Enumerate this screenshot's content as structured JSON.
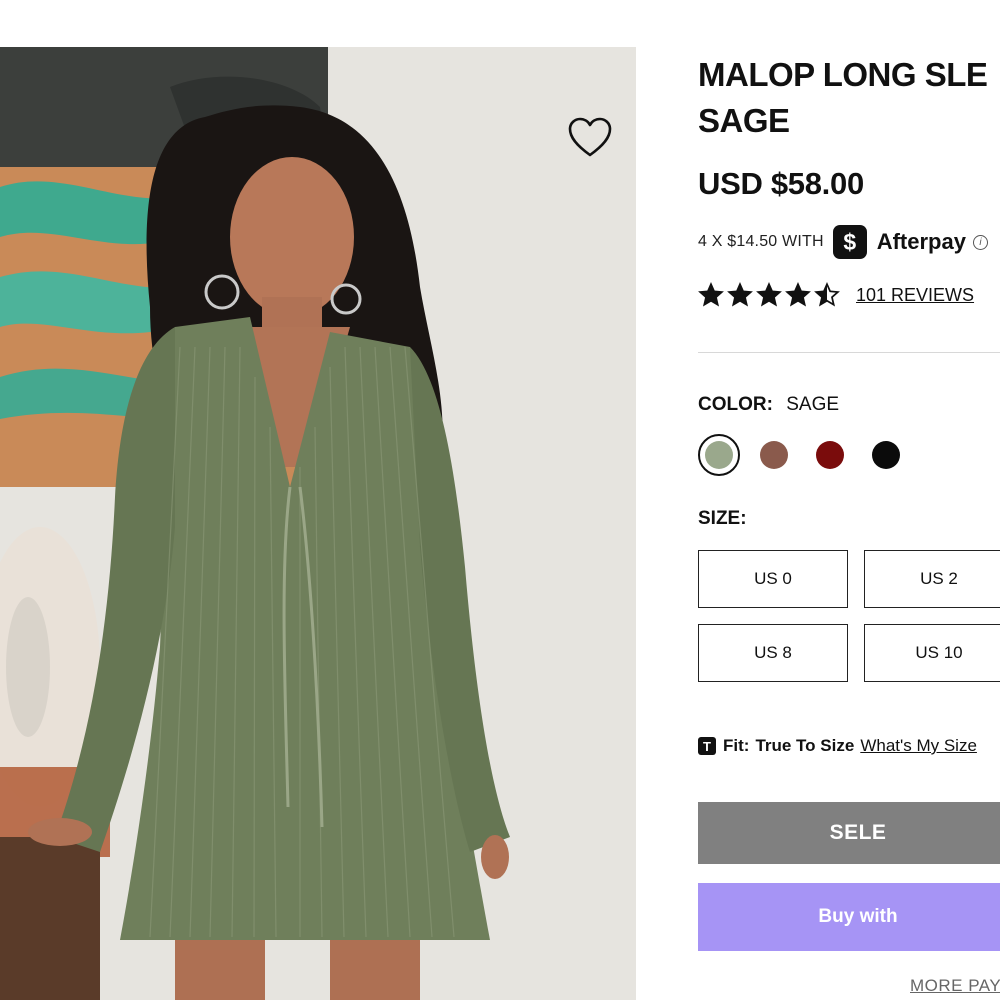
{
  "product": {
    "title_line1": "MALOP LONG SLE",
    "title_line2": "SAGE",
    "price": "USD $58.00",
    "image_alt_icon": "product-photo"
  },
  "afterpay": {
    "installments_text": "4 X $14.50 WITH",
    "badge_glyph": "$",
    "brand": "Afterpay",
    "info_glyph": "i"
  },
  "rating": {
    "stars": 4.5,
    "reviews_label": "101 REVIEWS"
  },
  "color": {
    "label": "COLOR:",
    "selected": "SAGE",
    "swatches": [
      {
        "name": "sage",
        "hex": "#9aa88c",
        "selected": true
      },
      {
        "name": "brown",
        "hex": "#8a5a4c",
        "selected": false
      },
      {
        "name": "burgundy",
        "hex": "#7a0c0c",
        "selected": false
      },
      {
        "name": "black",
        "hex": "#0b0b0b",
        "selected": false
      }
    ]
  },
  "size": {
    "label": "SIZE:",
    "options": [
      "US 0",
      "US 2",
      "US 8",
      "US 10"
    ]
  },
  "fit": {
    "icon_glyph": "T",
    "label": "Fit:",
    "value": "True To Size",
    "link": "What's My Size"
  },
  "actions": {
    "select_label": "SELE",
    "buy_label": "Buy with",
    "more_payment": "MORE PAY"
  },
  "colors": {
    "select_button": "#808080",
    "buy_button": "#a694f5"
  }
}
